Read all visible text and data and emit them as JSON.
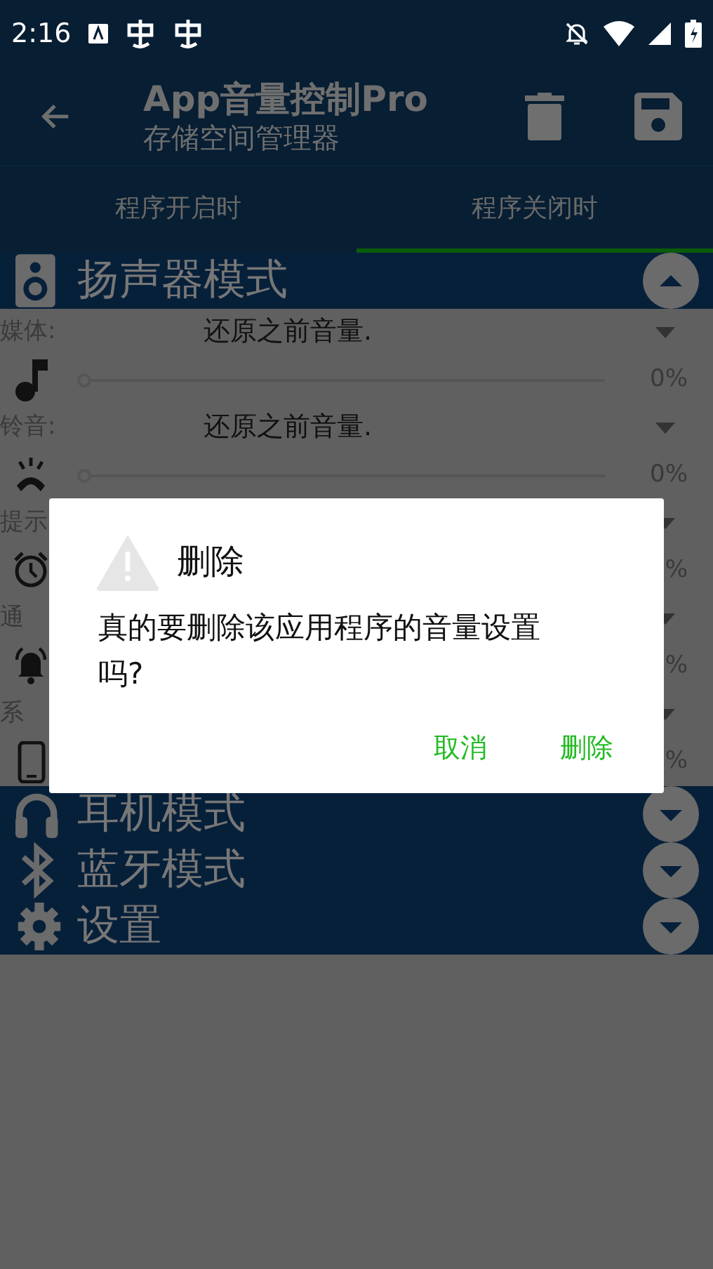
{
  "status_bar": {
    "time": "2:16"
  },
  "toolbar": {
    "title": "App音量控制Pro",
    "subtitle": "存储空间管理器"
  },
  "tabs": [
    {
      "label": "程序开启时",
      "selected": false
    },
    {
      "label": "程序关闭时",
      "selected": true
    }
  ],
  "sections": [
    {
      "kind": "speaker",
      "title": "扬声器模式",
      "expanded": true,
      "rows": [
        {
          "kind": "media",
          "label": "媒体:",
          "value": "还原之前音量.",
          "level": 0,
          "reading": "0%"
        },
        {
          "kind": "ring",
          "label": "铃音:",
          "value": "还原之前音量.",
          "level": 0,
          "reading": "0%"
        },
        {
          "kind": "alarm",
          "label": "提示",
          "reading": "%"
        },
        {
          "kind": "notify",
          "label": "通",
          "reading": "%"
        },
        {
          "kind": "system",
          "label": "系",
          "reading": "%"
        }
      ]
    },
    {
      "kind": "headphones",
      "title": "耳机模式",
      "expanded": false
    },
    {
      "kind": "bluetooth",
      "title": "蓝牙模式",
      "expanded": false
    },
    {
      "kind": "settings",
      "title": "设置",
      "expanded": false
    }
  ],
  "dialog": {
    "title": "删除",
    "message": "真的要删除该应用程序的音量设置吗?",
    "buttons": [
      "取消",
      "删除"
    ]
  }
}
